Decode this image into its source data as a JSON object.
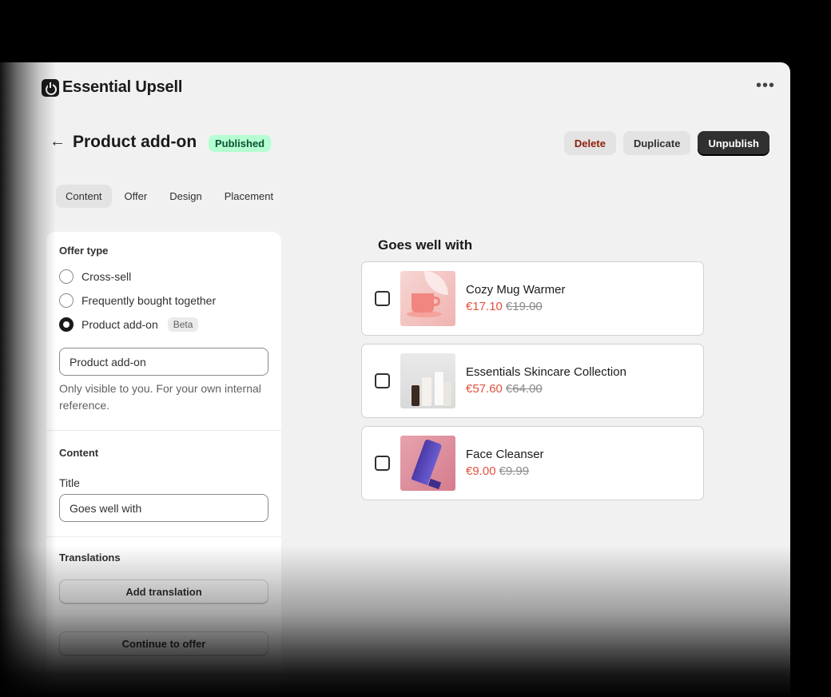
{
  "app": {
    "title": "Essential Upsell",
    "more_label": "•••"
  },
  "page": {
    "back_label": "←",
    "title": "Product add-on",
    "status": "Published",
    "actions": {
      "delete": "Delete",
      "duplicate": "Duplicate",
      "unpublish": "Unpublish"
    }
  },
  "tabs": [
    {
      "label": "Content",
      "active": true
    },
    {
      "label": "Offer"
    },
    {
      "label": "Design"
    },
    {
      "label": "Placement"
    }
  ],
  "sidebar": {
    "offer_type": {
      "title": "Offer type",
      "options": [
        "Cross-sell",
        "Frequently bought together",
        "Product add-on"
      ],
      "selected": "Product add-on",
      "beta_label": "Beta",
      "name_value": "Product add-on",
      "help": "Only visible to you. For your own internal reference."
    },
    "content": {
      "title": "Content",
      "title_label": "Title",
      "title_value": "Goes well with"
    },
    "translations": {
      "title": "Translations",
      "add_label": "Add translation"
    },
    "continue_label": "Continue to offer"
  },
  "preview": {
    "title": "Goes well with",
    "products": [
      {
        "name": "Cozy Mug Warmer",
        "price": "€17.10",
        "compare": "€19.00"
      },
      {
        "name": "Essentials Skincare Collection",
        "price": "€57.60",
        "compare": "€64.00"
      },
      {
        "name": "Face Cleanser",
        "price": "€9.00",
        "compare": "€9.99"
      }
    ]
  },
  "colors": {
    "badge_bg": "#b4fed2",
    "price": "#e1523d",
    "primary": "#303030",
    "danger_text": "#8e1f0b"
  }
}
